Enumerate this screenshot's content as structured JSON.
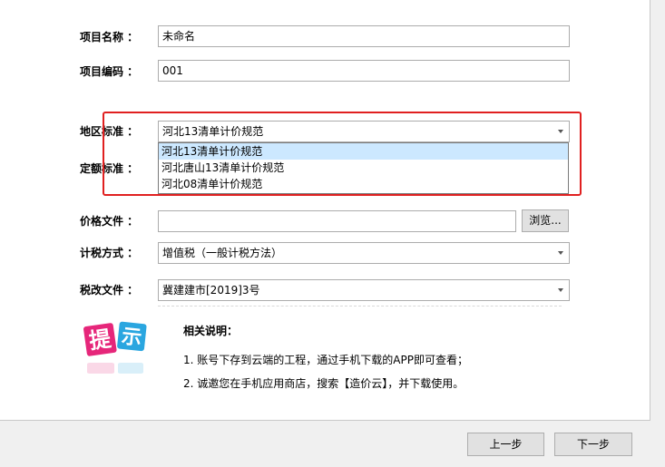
{
  "form": {
    "project_name_label": "项目名称 ：",
    "project_name_value": "未命名",
    "project_code_label": "项目编码 ：",
    "project_code_value": "001",
    "region_standard_label": "地区标准 ：",
    "region_standard_value": "河北13清单计价规范",
    "quota_standard_label": "定额标准 ：",
    "price_file_label": "价格文件 ：",
    "price_file_value": "",
    "browse_label": "浏览...",
    "tax_method_label": "计税方式 ：",
    "tax_method_value": "增值税（一般计税方法）",
    "tax_reform_label": "税改文件 ：",
    "tax_reform_value": "冀建建市[2019]3号"
  },
  "dropdown": {
    "options": [
      "河北13清单计价规范",
      "河北唐山13清单计价规范",
      "河北08清单计价规范"
    ],
    "selected_index": 0
  },
  "tip": {
    "icon_text_1": "提",
    "icon_text_2": "示",
    "title": "相关说明：",
    "notes": [
      "1. 账号下存到云端的工程，通过手机下载的APP即可查看；",
      "2. 诚邀您在手机应用商店，搜索【造价云】，并下载使用。"
    ]
  },
  "footer": {
    "prev_label": "上一步",
    "next_label": "下一步"
  },
  "colors": {
    "highlight_border": "#e02020",
    "selected_option_bg": "#cce8ff",
    "tip_pink": "#e6267a",
    "tip_blue": "#2aa6e0"
  }
}
